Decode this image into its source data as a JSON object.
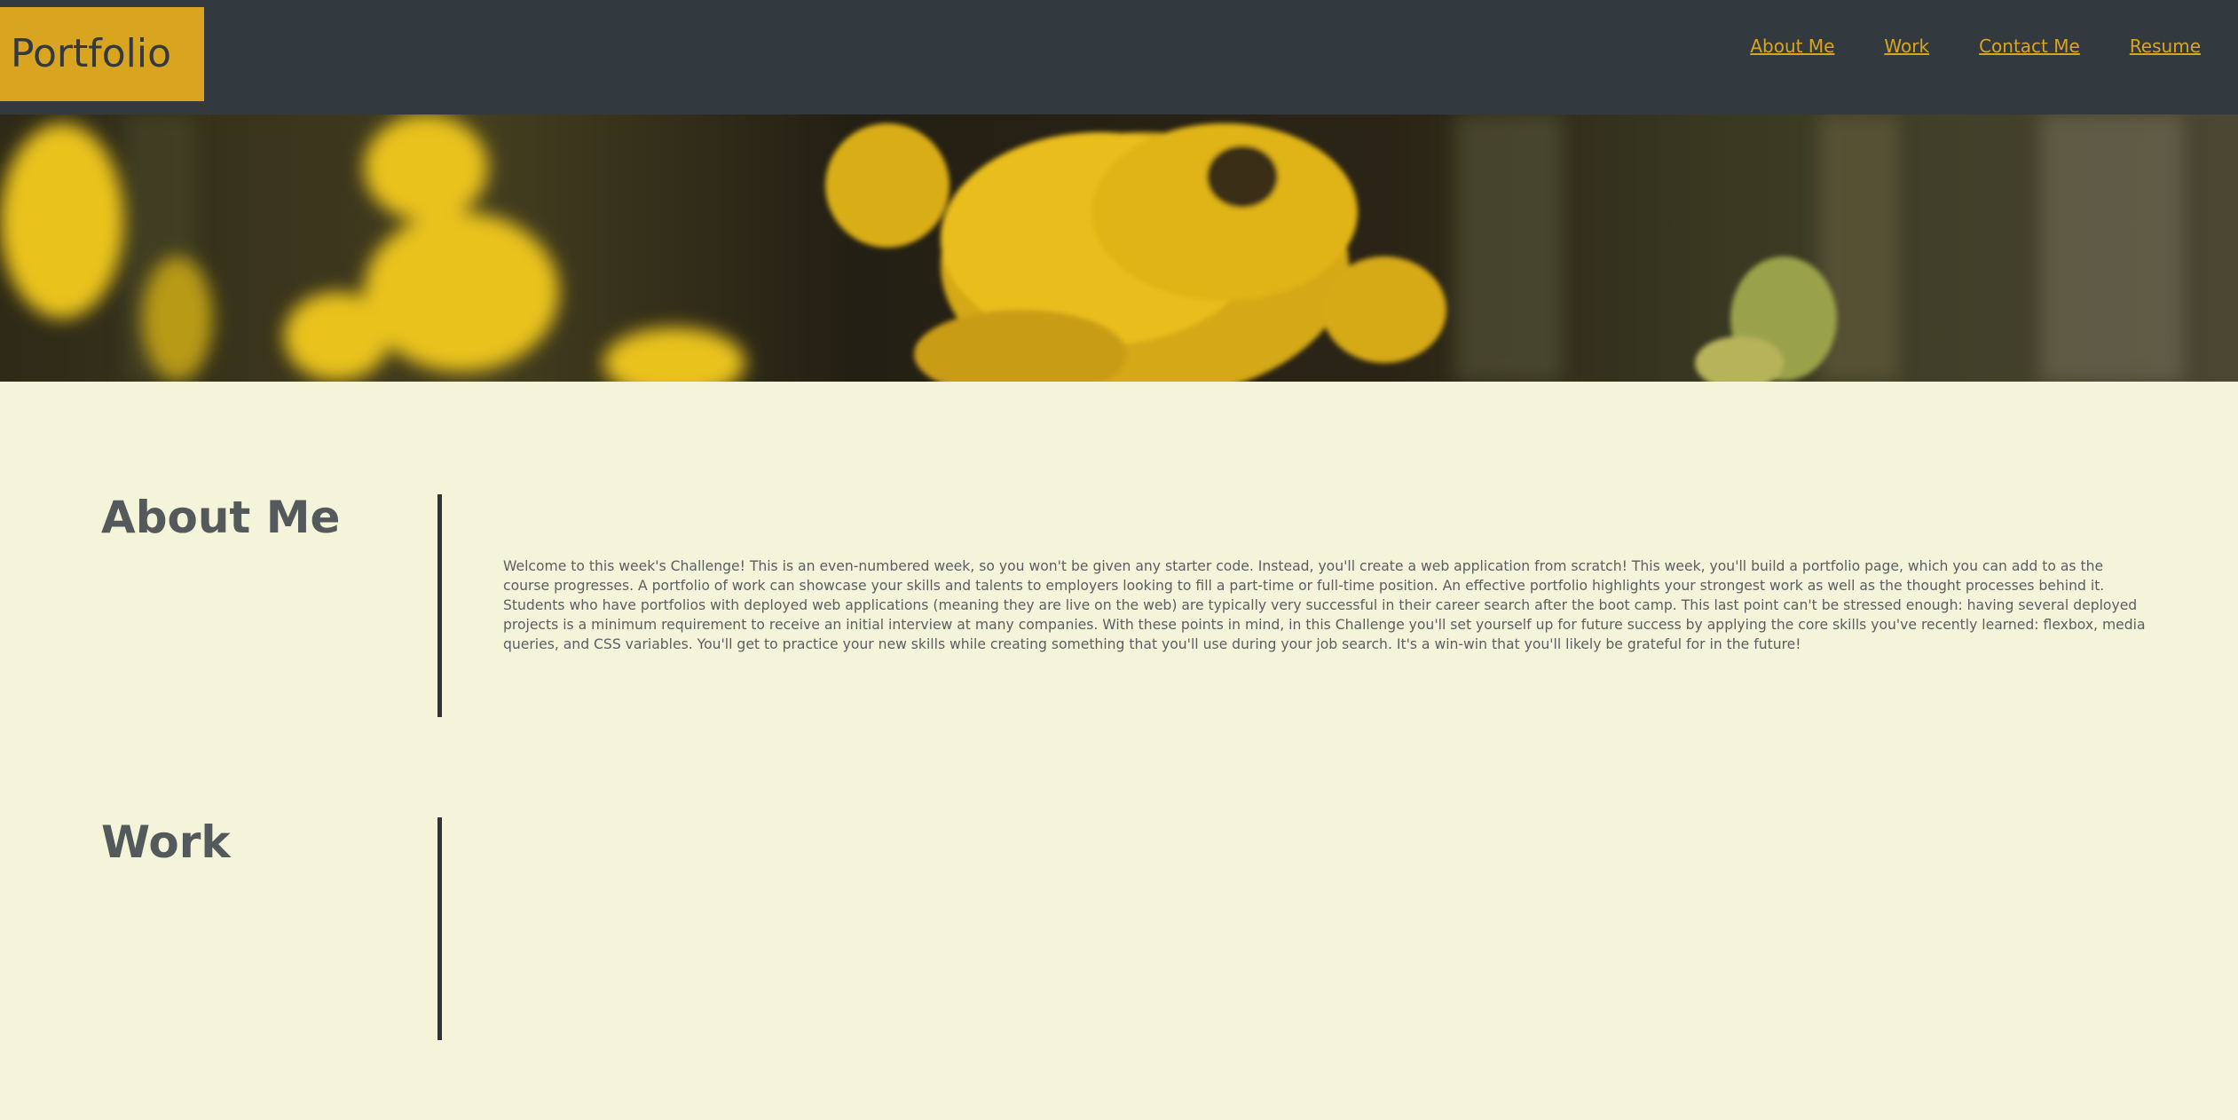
{
  "header": {
    "logo": "Portfolio",
    "nav": [
      {
        "label": "About Me"
      },
      {
        "label": "Work"
      },
      {
        "label": "Contact Me"
      },
      {
        "label": "Resume"
      }
    ]
  },
  "hero": {
    "image": "yellow-flowers-banner"
  },
  "about": {
    "title": "About Me",
    "text": "Welcome to this week's Challenge! This is an even-numbered week, so you won't be given any starter code. Instead, you'll create a web application from scratch! This week, you'll build a portfolio page, which you can add to as the course progresses. A portfolio of work can showcase your skills and talents to employers looking to fill a part-time or full-time position. An effective portfolio highlights your strongest work as well as the thought processes behind it. Students who have portfolios with deployed web applications (meaning they are live on the web) are typically very successful in their career search after the boot camp. This last point can't be stressed enough: having several deployed projects is a minimum requirement to receive an initial interview at many companies. With these points in mind, in this Challenge you'll set yourself up for future success by applying the core skills you've recently learned: flexbox, media queries, and CSS variables. You'll get to practice your new skills while creating something that you'll use during your job search. It's a win-win that you'll likely be grateful for in the future!"
  },
  "work": {
    "title": "Work"
  },
  "colors": {
    "header_bg": "#333a3f",
    "accent": "#d9a520",
    "page_bg": "#f3f4da",
    "heading": "#54595c"
  }
}
